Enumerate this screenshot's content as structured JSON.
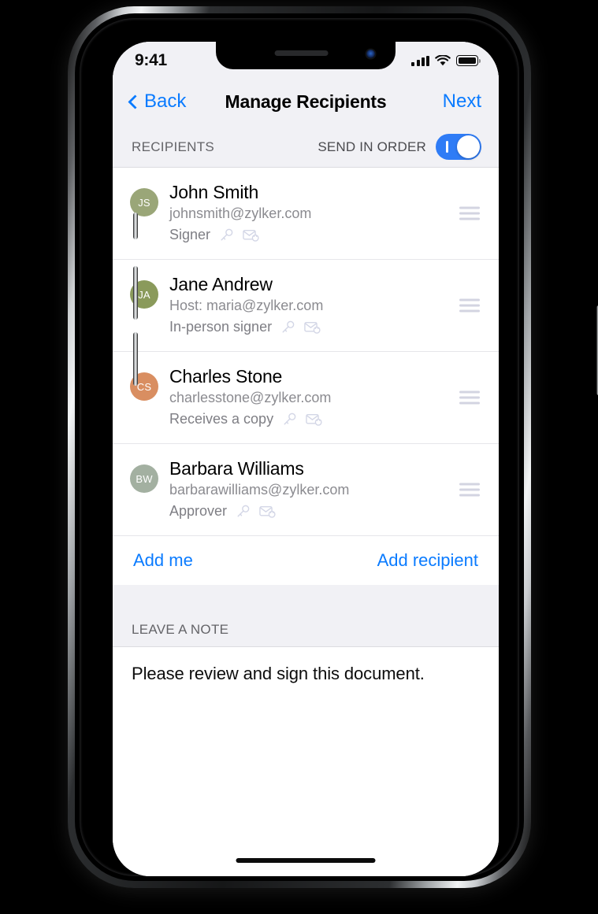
{
  "status_bar": {
    "time": "9:41",
    "signal_icon": "cellular-bars-icon",
    "wifi_icon": "wifi-icon",
    "battery_icon": "battery-full-icon"
  },
  "nav": {
    "back_label": "Back",
    "title": "Manage Recipients",
    "next_label": "Next"
  },
  "recipients_section": {
    "header": "RECIPIENTS",
    "send_in_order_label": "SEND IN ORDER",
    "send_in_order_on": true,
    "toggle_color": "#2f7cf6"
  },
  "recipients": [
    {
      "initials": "JS",
      "name": "John Smith",
      "email": "johnsmith@zylker.com",
      "role": "Signer",
      "avatar_color": "#9aa678",
      "key_icon": "key-icon",
      "mail_lock_icon": "mail-lock-icon",
      "drag_icon": "drag-handle-icon"
    },
    {
      "initials": "JA",
      "name": "Jane Andrew",
      "email": "Host: maria@zylker.com",
      "role": "In-person signer",
      "avatar_color": "#8a9a5b",
      "key_icon": "key-icon",
      "mail_lock_icon": "mail-lock-icon",
      "drag_icon": "drag-handle-icon"
    },
    {
      "initials": "CS",
      "name": "Charles Stone",
      "email": "charlesstone@zylker.com",
      "role": "Receives a copy",
      "avatar_color": "#d98e61",
      "key_icon": "key-icon",
      "mail_lock_icon": "mail-lock-icon",
      "drag_icon": "drag-handle-icon"
    },
    {
      "initials": "BW",
      "name": "Barbara Williams",
      "email": "barbarawilliams@zylker.com",
      "role": "Approver",
      "avatar_color": "#a3b0a1",
      "key_icon": "key-icon",
      "mail_lock_icon": "mail-lock-icon",
      "drag_icon": "drag-handle-icon"
    }
  ],
  "actions": {
    "add_me": "Add me",
    "add_recipient": "Add recipient",
    "link_color": "#0a7bff"
  },
  "note_section": {
    "header": "LEAVE A NOTE",
    "value": "Please review and sign this document.",
    "placeholder": "Please review and sign this document."
  }
}
